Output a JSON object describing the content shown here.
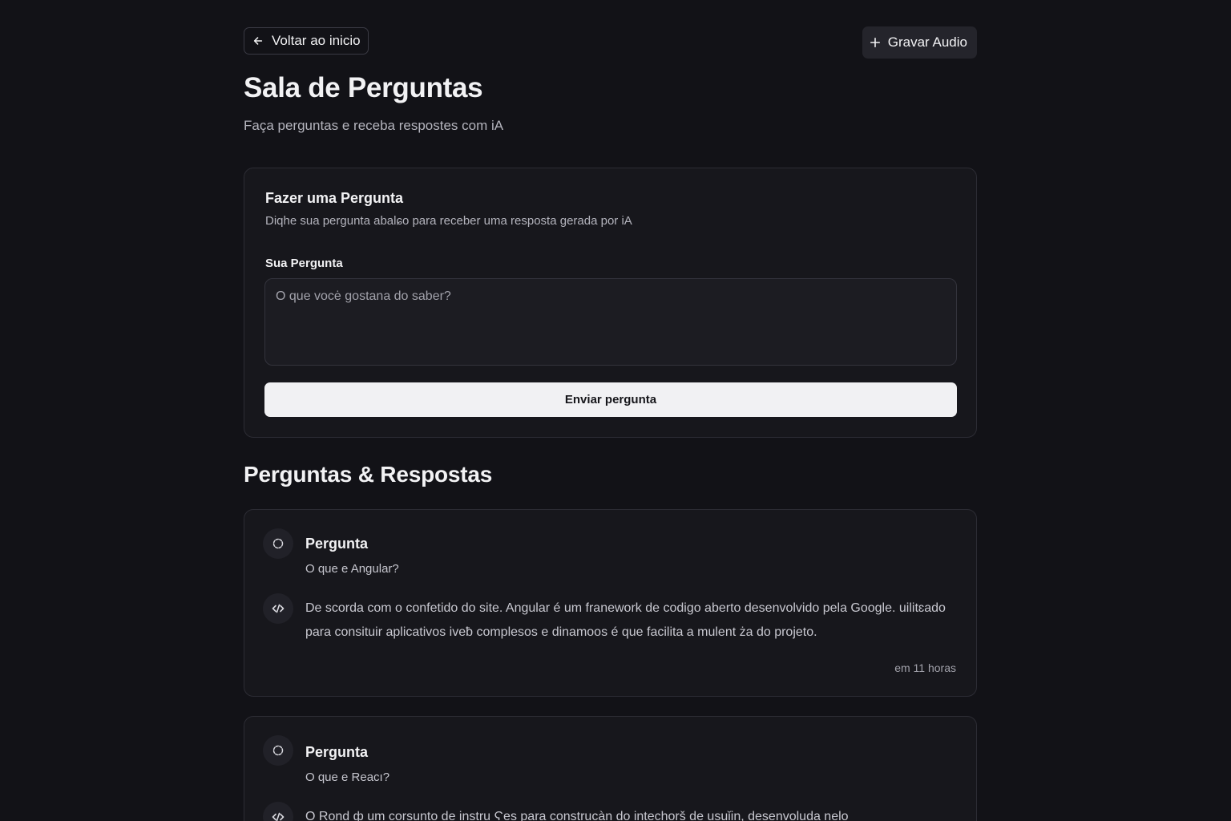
{
  "header": {
    "back_label": "Voltar ao inicio",
    "record_label": "Gravar Audio",
    "title": "Sala de Perguntas",
    "subtitle": "Faça perguntas e receba respostes com iA"
  },
  "ask_card": {
    "title": "Fazer uma Pergunta",
    "description": "Diqhe sua pergunta abalɕo para receber uma resposta gerada por iA",
    "field_label": "Sua Pergunta",
    "placeholder": "O que vocė gostana do saber?",
    "submit_label": "Enviar pergunta"
  },
  "qa_section": {
    "title": "Perguntas & Respostas",
    "items": [
      {
        "label": "Pergunta",
        "question": "O que e Angular?",
        "answer": "De scorda com o confetido do site. Angular é um franework de codigo aberto desenvolvido pela Google. uilitɛado para consituir aplicativos iveƀ complesos e dinamoos é que facilita a mulent ża do projeto.",
        "time": "em 11 horas"
      },
      {
        "label": "Pergunta",
        "question": "O que e Reacı?",
        "answer": "O Rond ф um corsunto de instru Ϛes para construcàn do intechorš de usuǐin, desenvoluda nelo"
      }
    ]
  },
  "icons": {
    "back": "arrow-left-icon",
    "record": "plus-icon",
    "question": "loader-circle-icon",
    "answer": "code-icon"
  }
}
